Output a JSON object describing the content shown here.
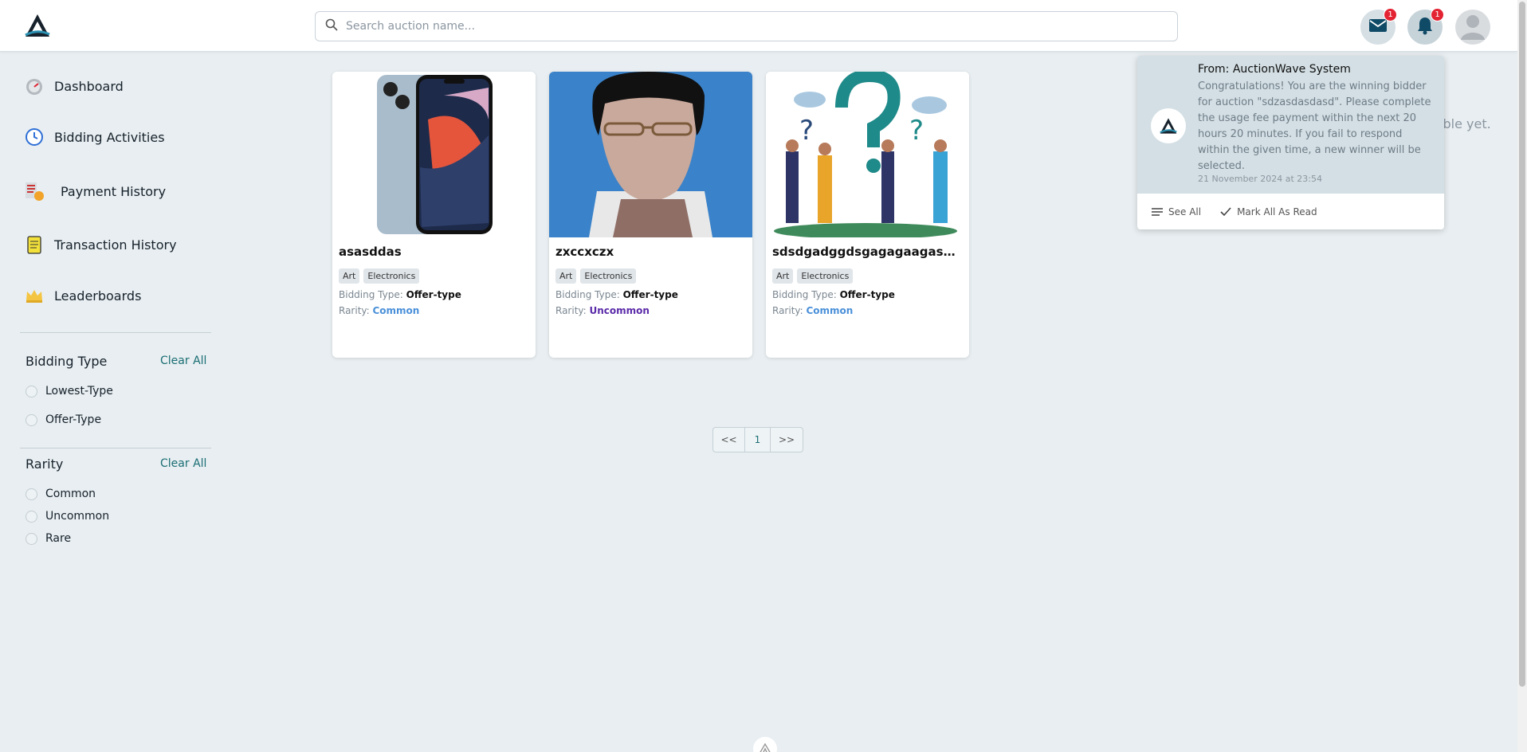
{
  "header": {
    "search_placeholder": "Search auction name...",
    "mail_badge": "1",
    "bell_badge": "1"
  },
  "sidebar": {
    "nav": [
      {
        "label": "Dashboard"
      },
      {
        "label": "Bidding Activities"
      },
      {
        "label": "Payment History"
      },
      {
        "label": "Transaction History"
      },
      {
        "label": "Leaderboards"
      }
    ],
    "bidding_type": {
      "title": "Bidding Type",
      "clear": "Clear All",
      "options": [
        "Lowest-Type",
        "Offer-Type"
      ]
    },
    "rarity": {
      "title": "Rarity",
      "clear": "Clear All",
      "options": [
        "Common",
        "Uncommon",
        "Rare"
      ]
    }
  },
  "cards": [
    {
      "title": "asasddas",
      "tags": [
        "Art",
        "Electronics"
      ],
      "bidding_label": "Bidding Type:",
      "bidding": "Offer-type",
      "rarity_label": "Rarity:",
      "rarity": "Common",
      "rarity_color": "#4a90d9"
    },
    {
      "title": "zxccxczx",
      "tags": [
        "Art",
        "Electronics"
      ],
      "bidding_label": "Bidding Type:",
      "bidding": "Offer-type",
      "rarity_label": "Rarity:",
      "rarity": "Uncommon",
      "rarity_color": "#5a2aa8"
    },
    {
      "title": "sdsdgadggdsgagagaagasdgasd...",
      "tags": [
        "Art",
        "Electronics"
      ],
      "bidding_label": "Bidding Type:",
      "bidding": "Offer-type",
      "rarity_label": "Rarity:",
      "rarity": "Common",
      "rarity_color": "#4a90d9"
    }
  ],
  "pagination": {
    "prev": "<<",
    "current": "1",
    "next": ">>"
  },
  "background_text": "ailable yet.",
  "notification": {
    "from": "From: AuctionWave System",
    "message": "Congratulations! You are the winning bidder for auction \"sdzasdasdasd\". Please complete the usage fee payment within the next 20 hours 20 minutes. If you fail to respond within the given time, a new winner will be selected.",
    "time": "21 November 2024 at 23:54",
    "see_all": "See All",
    "mark_all": "Mark All As Read"
  },
  "colors": {
    "accent": "#1a6e74",
    "background": "#e8eef1",
    "badge": "#e32232"
  }
}
